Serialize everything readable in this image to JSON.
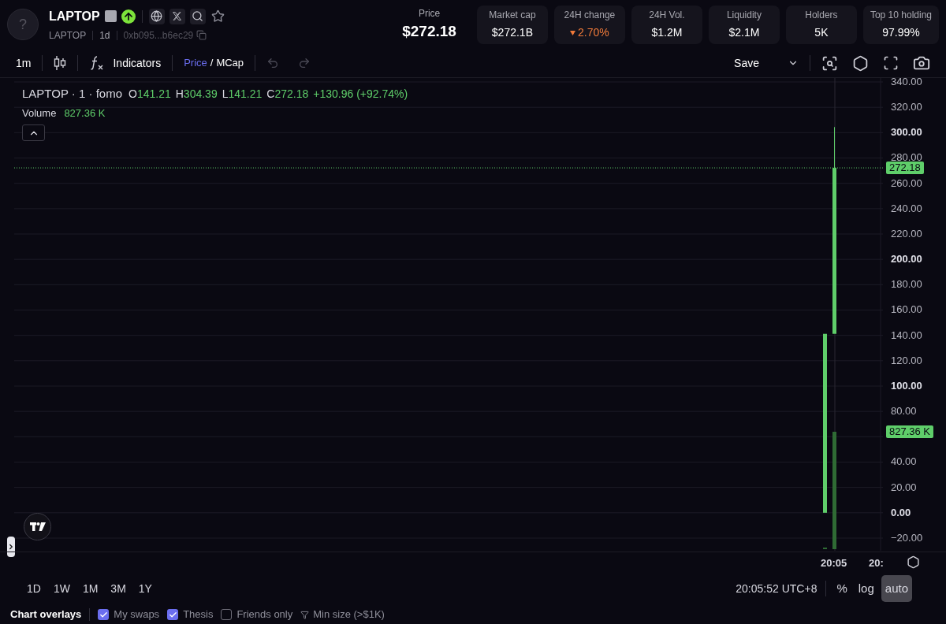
{
  "token": {
    "avatar": "?",
    "name": "LAPTOP",
    "symbol": "LAPTOP",
    "age": "1d",
    "address": "0xb095...b6ec29"
  },
  "price": {
    "label": "Price",
    "value": "$272.18"
  },
  "stats": [
    {
      "label": "Market cap",
      "value": "$272.1B",
      "falling": false
    },
    {
      "label": "24H change",
      "value": "2.70%",
      "falling": true
    },
    {
      "label": "24H Vol.",
      "value": "$1.2M",
      "falling": false
    },
    {
      "label": "Liquidity",
      "value": "$2.1M",
      "falling": false
    },
    {
      "label": "Holders",
      "value": "5K",
      "falling": false
    },
    {
      "label": "Top 10 holding",
      "value": "97.99%",
      "falling": false
    }
  ],
  "toolbar": {
    "interval": "1m",
    "indicators": "Indicators",
    "modes": [
      {
        "label": "Price",
        "selected": true
      },
      {
        "label": "MCap",
        "selected": false
      }
    ],
    "separator": "/",
    "undo_disabled": true,
    "redo_disabled": true,
    "save": "Save"
  },
  "legend": {
    "title": "LAPTOP · 1 · fomo",
    "ohlc": [
      {
        "label": "O",
        "value": "141.21"
      },
      {
        "label": "H",
        "value": "304.39"
      },
      {
        "label": "L",
        "value": "141.21"
      },
      {
        "label": "C",
        "value": "272.18"
      }
    ],
    "change": "+130.96 (+92.74%)",
    "volume_label": "Volume",
    "volume_value": "827.36 K"
  },
  "price_axis": [
    {
      "label": "340.00",
      "major": false
    },
    {
      "label": "320.00",
      "major": false
    },
    {
      "label": "300.00",
      "major": true
    },
    {
      "label": "280.00",
      "major": false
    },
    {
      "label": "260.00",
      "major": false
    },
    {
      "label": "240.00",
      "major": false
    },
    {
      "label": "220.00",
      "major": false
    },
    {
      "label": "200.00",
      "major": true
    },
    {
      "label": "180.00",
      "major": false
    },
    {
      "label": "160.00",
      "major": false
    },
    {
      "label": "140.00",
      "major": false
    },
    {
      "label": "120.00",
      "major": false
    },
    {
      "label": "100.00",
      "major": true
    },
    {
      "label": "80.00",
      "major": false
    },
    {
      "label": "40.00",
      "major": false
    },
    {
      "label": "20.00",
      "major": false
    },
    {
      "label": "0.00",
      "major": true
    },
    {
      "label": "−20.00",
      "major": false
    }
  ],
  "price_tag": "272.18",
  "volume_tag": "827.36 K",
  "time_axis": [
    "20:05",
    "20:"
  ],
  "ranges": [
    "1D",
    "1W",
    "1M",
    "3M",
    "1Y"
  ],
  "clock": "20:05:52 UTC+8",
  "scales": [
    {
      "label": "%",
      "selected": false
    },
    {
      "label": "log",
      "selected": false
    },
    {
      "label": "auto",
      "selected": true
    }
  ],
  "overlays": {
    "title": "Chart overlays",
    "options": [
      {
        "label": "My swaps",
        "checked": true
      },
      {
        "label": "Thesis",
        "checked": true
      },
      {
        "label": "Friends only",
        "checked": false
      }
    ],
    "min_size": "Min size (>$1K)"
  }
}
